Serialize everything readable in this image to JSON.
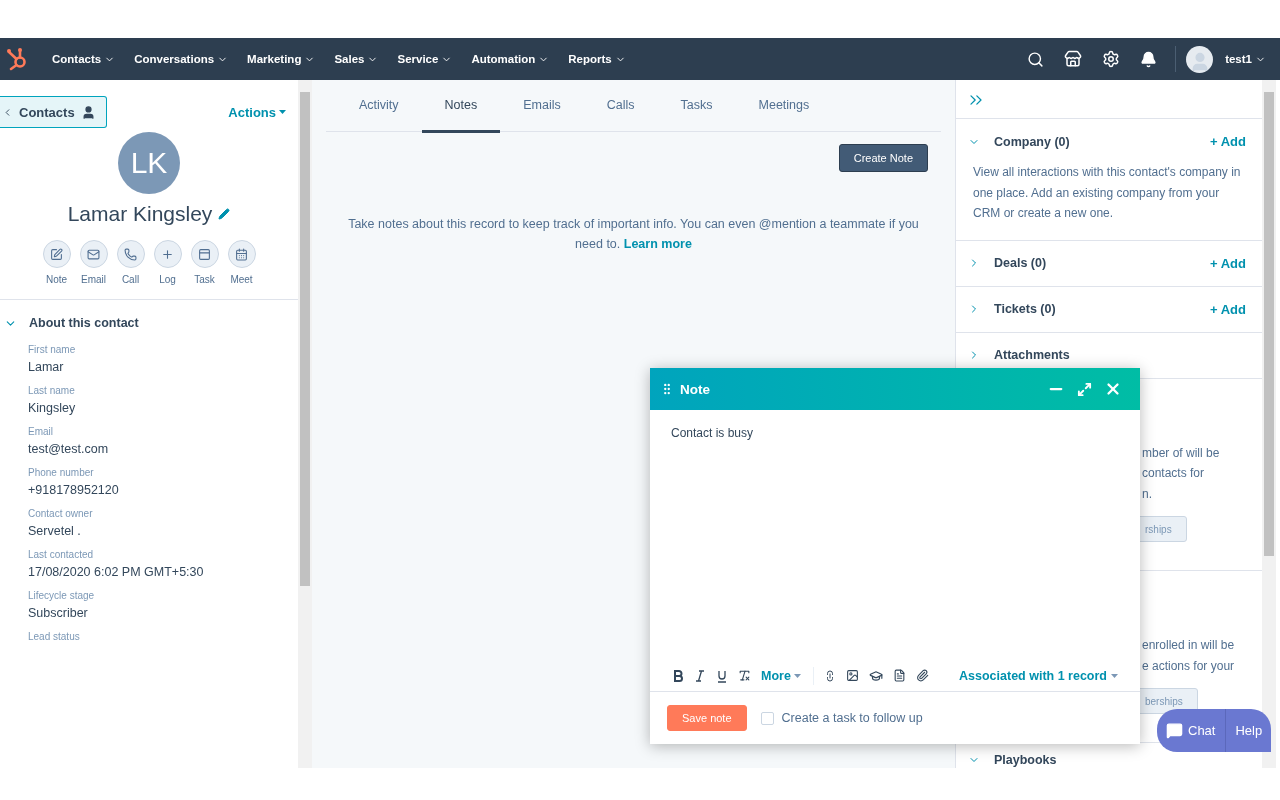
{
  "nav": {
    "items": [
      {
        "label": "Contacts"
      },
      {
        "label": "Conversations"
      },
      {
        "label": "Marketing"
      },
      {
        "label": "Sales"
      },
      {
        "label": "Service"
      },
      {
        "label": "Automation"
      },
      {
        "label": "Reports"
      }
    ],
    "user": "test1"
  },
  "contact": {
    "back": "Contacts",
    "actions": "Actions",
    "initials": "LK",
    "name": "Lamar Kingsley",
    "quick_actions": [
      {
        "label": "Note",
        "kind": "note"
      },
      {
        "label": "Email",
        "kind": "email"
      },
      {
        "label": "Call",
        "kind": "call"
      },
      {
        "label": "Log",
        "kind": "log"
      },
      {
        "label": "Task",
        "kind": "task"
      },
      {
        "label": "Meet",
        "kind": "meet"
      }
    ]
  },
  "about": {
    "title": "About this contact",
    "expanded": true,
    "fields": [
      {
        "label": "First name",
        "value": "Lamar"
      },
      {
        "label": "Last name",
        "value": "Kingsley"
      },
      {
        "label": "Email",
        "value": "test@test.com"
      },
      {
        "label": "Phone number",
        "value": "+918178952120"
      },
      {
        "label": "Contact owner",
        "value": "Servetel ."
      },
      {
        "label": "Last contacted",
        "value": "17/08/2020 6:02 PM GMT+5:30"
      },
      {
        "label": "Lifecycle stage",
        "value": "Subscriber"
      },
      {
        "label": "Lead status"
      }
    ]
  },
  "center": {
    "tabs": [
      {
        "label": "Activity",
        "selected": false
      },
      {
        "label": "Notes",
        "selected": true
      },
      {
        "label": "Emails",
        "selected": false
      },
      {
        "label": "Calls",
        "selected": false
      },
      {
        "label": "Tasks",
        "selected": false
      },
      {
        "label": "Meetings",
        "selected": false
      }
    ],
    "create_button": "Create Note",
    "empty_text": "Take notes about this record to keep track of important info. You can even @mention a teammate if you need to.",
    "link": "Learn more"
  },
  "right": {
    "sections": [
      {
        "title": "Company (0)",
        "expanded": true,
        "add": "+ Add",
        "text": "View all interactions with this contact's company in one place. Add an existing company from your CRM or create a new one."
      },
      {
        "title": "Deals (0)",
        "expanded": false,
        "add": "+ Add"
      },
      {
        "title": "Tickets (0)",
        "expanded": false,
        "add": "+ Add"
      },
      {
        "title": "Attachments",
        "expanded": false
      }
    ],
    "fragments": [
      {
        "lines": [
          "mber of will be",
          "contacts for",
          "n."
        ],
        "button": "rships"
      },
      {
        "lines": [
          "enrolled in will be",
          "e actions for your"
        ],
        "button": "berships"
      }
    ],
    "last_section": {
      "title": "Playbooks",
      "expanded": true
    }
  },
  "note_editor": {
    "title": "Note",
    "value": "Contact is busy",
    "more": "More",
    "associated": "Associated with 1 record",
    "save": "Save note",
    "task_checkbox": {
      "label": "Create a task to follow up",
      "checked": false
    }
  },
  "chat": {
    "chat": "Chat",
    "help": "Help"
  }
}
